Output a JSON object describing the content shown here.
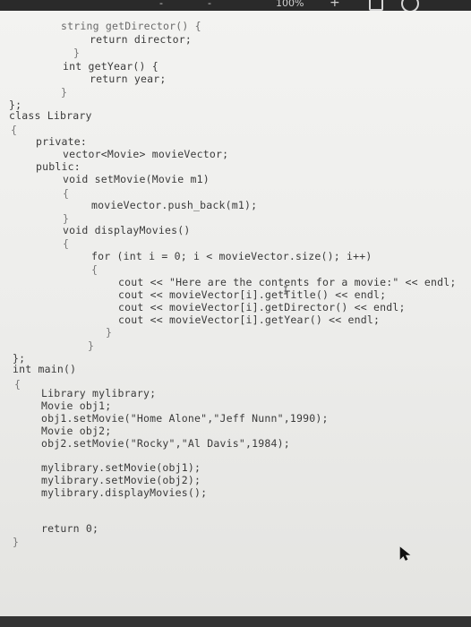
{
  "status_bar": {
    "battery_text": "100%",
    "plus_icon": "plus-icon",
    "share_icon": "share-box-icon",
    "markup_icon": "circle-check-icon"
  },
  "code": {
    "lines": [
      "string getDirector() {",
      "return director;",
      "}",
      "int getYear() {",
      "return year;",
      "}",
      "};",
      "class Library",
      "{",
      "private:",
      "vector<Movie> movieVector;",
      "public:",
      "void setMovie(Movie m1)",
      "{",
      "movieVector.push_back(m1);",
      "}",
      "void displayMovies()",
      "{",
      "for (int i = 0; i < movieVector.size(); i++)",
      "{",
      "cout << \"Here are the contents for a movie:\" << endl;",
      "cout << movieVector[i].getTitle() << endl;",
      "cout << movieVector[i].getDirector() << endl;",
      "cout << movieVector[i].getYear() << endl;",
      "}",
      "}",
      "};",
      "int main()",
      "{",
      "Library mylibrary;",
      "Movie obj1;",
      "obj1.setMovie(\"Home Alone\",\"Jeff Nunn\",1990);",
      "Movie obj2;",
      "obj2.setMovie(\"Rocky\",\"Al Davis\",1984);",
      "mylibrary.setMovie(obj1);",
      "mylibrary.setMovie(obj2);",
      "mylibrary.displayMovies();",
      "return 0;",
      "}"
    ]
  }
}
